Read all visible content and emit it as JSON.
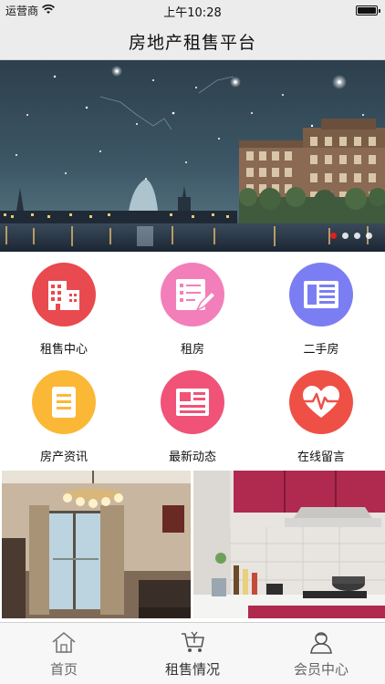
{
  "status_bar": {
    "carrier": "运营商",
    "time": "上午10:28"
  },
  "nav": {
    "title": "房地产租售平台"
  },
  "banner": {
    "slide_count": 4,
    "active_slide": 1
  },
  "menu": {
    "items": [
      {
        "label": "租售中心",
        "icon": "building-icon",
        "color": "#e84a4f"
      },
      {
        "label": "租房",
        "icon": "document-edit-icon",
        "color": "#f27fb9"
      },
      {
        "label": "二手房",
        "icon": "newspaper-icon",
        "color": "#7b7ef2"
      },
      {
        "label": "房产资讯",
        "icon": "notes-icon",
        "color": "#fbb836"
      },
      {
        "label": "最新动态",
        "icon": "news-icon",
        "color": "#f05377"
      },
      {
        "label": "在线留言",
        "icon": "heartbeat-icon",
        "color": "#ef5046"
      }
    ]
  },
  "tabbar": {
    "items": [
      {
        "label": "首页",
        "icon": "home-icon"
      },
      {
        "label": "租售情况",
        "icon": "cart-icon"
      },
      {
        "label": "会员中心",
        "icon": "user-icon"
      }
    ]
  }
}
